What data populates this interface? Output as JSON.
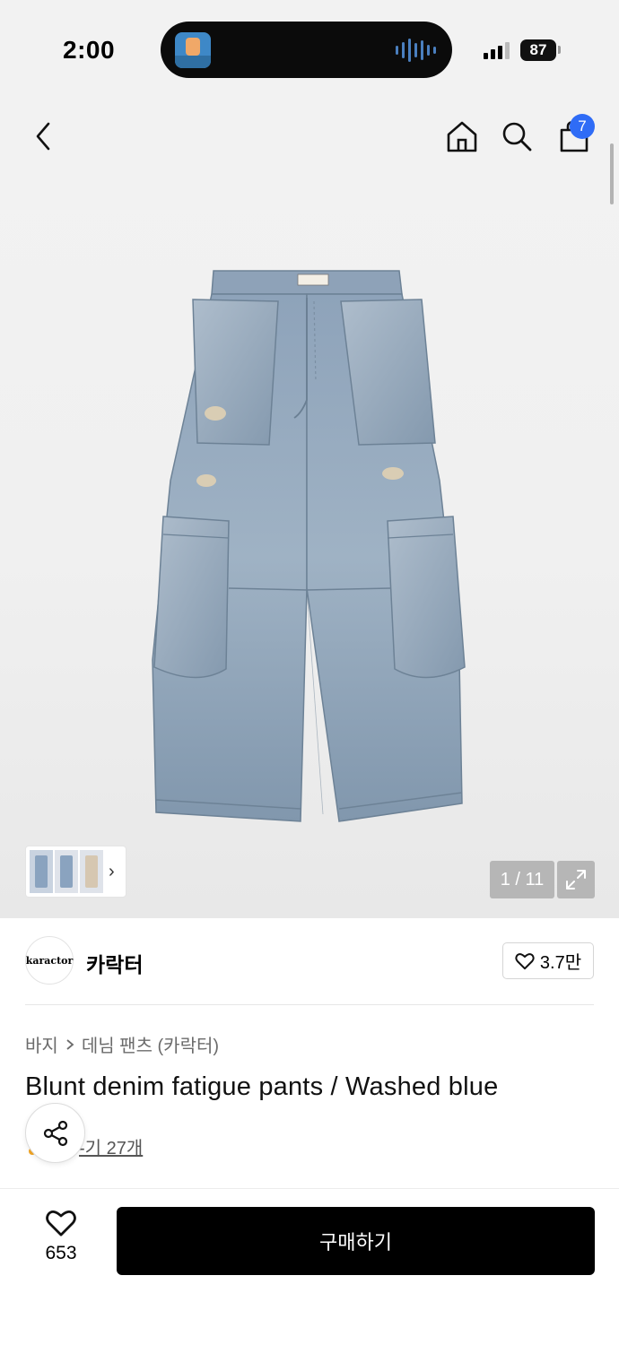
{
  "status_bar": {
    "time": "2:00",
    "battery": "87"
  },
  "header": {
    "cart_count": "7"
  },
  "gallery": {
    "counter": "1 / 11",
    "thumbs_chevron": "›"
  },
  "brand": {
    "logo_text": "karactor",
    "name": "카락터",
    "likes": "3.7만"
  },
  "product": {
    "breadcrumb": [
      "바지",
      "데님 팬츠 (카락터)"
    ],
    "title": "Blunt denim fatigue pants / Washed blue",
    "review_link": "후기 27개",
    "review_link_visible": "-기 27개"
  },
  "bottom_bar": {
    "wish_count": "653",
    "buy_label": "구매하기"
  },
  "colors": {
    "badge": "#2f6cf6",
    "buy_button": "#000000",
    "denim": "#8fa6bd"
  },
  "icons": [
    "back-icon",
    "home-icon",
    "search-icon",
    "cart-icon",
    "expand-icon",
    "heart-icon",
    "share-icon"
  ]
}
